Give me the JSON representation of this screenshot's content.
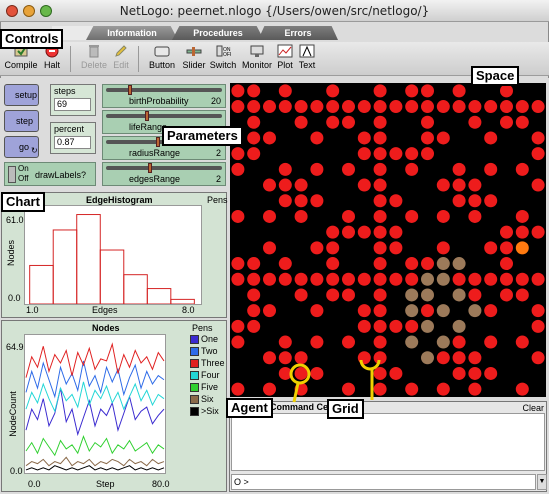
{
  "window": {
    "title": "NetLogo: peernet.nlogo {/Users/owen/src/netlogo/}"
  },
  "tabs": [
    {
      "label": "Information"
    },
    {
      "label": "Procedures"
    },
    {
      "label": "Errors"
    }
  ],
  "toolbar": {
    "compile": "Compile",
    "halt": "Halt",
    "delete": "Delete",
    "edit": "Edit",
    "button": "Button",
    "slider": "Slider",
    "switch": "Switch",
    "monitor": "Monitor",
    "plot": "Plot",
    "text": "Text"
  },
  "callouts": {
    "controls": "Controls",
    "space": "Space",
    "parameters": "Parameters",
    "chart": "Chart",
    "agent": "Agent",
    "grid": "Grid"
  },
  "buttons": {
    "setup": "setup",
    "step": "step",
    "go": "go"
  },
  "monitors": [
    {
      "label": "steps",
      "value": "69"
    },
    {
      "label": "percent",
      "value": "0.87"
    }
  ],
  "switch": {
    "on": "On",
    "off": "Off",
    "label": "drawLabels?"
  },
  "sliders": [
    {
      "label": "birthProbability",
      "value": "20",
      "fraction": 0.2
    },
    {
      "label": "lifeRange",
      "value": "",
      "fraction": 0.35
    },
    {
      "label": "radiusRange",
      "value": "2",
      "fraction": 0.45
    },
    {
      "label": "edgesRange",
      "value": "2",
      "fraction": 0.38
    }
  ],
  "edge_histogram": {
    "title": "EdgeHistogram",
    "pens_label": "Pens",
    "ymax_label": "61.0",
    "ymin_label": "0.0",
    "xmin_label": "1.0",
    "xmax_label": "8.0",
    "xlabel": "Edges",
    "ylabel": "Nodes"
  },
  "nodes_plot": {
    "title": "Nodes",
    "pens_label": "Pens",
    "ymax_label": "64.9",
    "ymin_label": "0.0",
    "xmin_label": "0.0",
    "xmax_label": "80.0",
    "xlabel": "Step",
    "ylabel": "NodeCount"
  },
  "command_center": {
    "title": "Command Center",
    "clear": "Clear",
    "prompt": "O >"
  },
  "chart_data": [
    {
      "type": "bar",
      "title": "EdgeHistogram",
      "xlabel": "Edges",
      "ylabel": "Nodes",
      "xlim": [
        1.0,
        8.0
      ],
      "ylim": [
        0.0,
        61.0
      ],
      "categories": [
        "1",
        "2",
        "3",
        "4",
        "5",
        "6",
        "7"
      ],
      "values": [
        25,
        48,
        58,
        35,
        19,
        10,
        3
      ],
      "color": "#d42020"
    },
    {
      "type": "line",
      "title": "Nodes",
      "xlabel": "Step",
      "ylabel": "NodeCount",
      "xlim": [
        0.0,
        80.0
      ],
      "ylim": [
        0.0,
        64.9
      ],
      "legend": "right",
      "series": [
        {
          "name": "One",
          "color": "#3a2ad0",
          "values": [
            20,
            30,
            25,
            35,
            22,
            28,
            40,
            24,
            30,
            18,
            26,
            34,
            22,
            30,
            27,
            33,
            20,
            28,
            36,
            25,
            29,
            31,
            23,
            27,
            30
          ]
        },
        {
          "name": "Two",
          "color": "#2d6be8",
          "values": [
            38,
            48,
            40,
            52,
            44,
            36,
            50,
            42,
            47,
            39,
            53,
            41,
            46,
            38,
            50,
            43,
            49,
            37,
            45,
            51,
            40,
            48,
            42,
            46,
            44
          ]
        },
        {
          "name": "Three",
          "color": "#e02020",
          "values": [
            45,
            55,
            50,
            60,
            48,
            56,
            52,
            58,
            46,
            57,
            51,
            59,
            49,
            54,
            53,
            61,
            47,
            56,
            50,
            58,
            52,
            55,
            49,
            57,
            53
          ]
        },
        {
          "name": "Four",
          "color": "#22d6d6",
          "values": [
            30,
            38,
            33,
            42,
            35,
            29,
            40,
            34,
            37,
            31,
            43,
            32,
            39,
            35,
            41,
            33,
            38,
            30,
            36,
            42,
            34,
            39,
            32,
            37,
            35
          ]
        },
        {
          "name": "Five",
          "color": "#30d030",
          "values": [
            10,
            14,
            9,
            16,
            12,
            8,
            15,
            11,
            13,
            9,
            17,
            10,
            14,
            12,
            16,
            9,
            13,
            11,
            15,
            10,
            12,
            14,
            9,
            13,
            11
          ]
        },
        {
          "name": "Six",
          "color": "#8a6a4a",
          "values": [
            3,
            5,
            4,
            6,
            3,
            5,
            4,
            7,
            3,
            5,
            4,
            6,
            3,
            5,
            4,
            6,
            5,
            3,
            6,
            4,
            5,
            3,
            6,
            4,
            5
          ]
        },
        {
          "name": ">Six",
          "color": "#000000",
          "values": [
            1,
            2,
            1,
            2,
            1,
            3,
            2,
            1,
            2,
            1,
            2,
            3,
            1,
            2,
            1,
            2,
            1,
            2,
            3,
            1,
            2,
            1,
            2,
            1,
            2
          ]
        }
      ]
    }
  ]
}
